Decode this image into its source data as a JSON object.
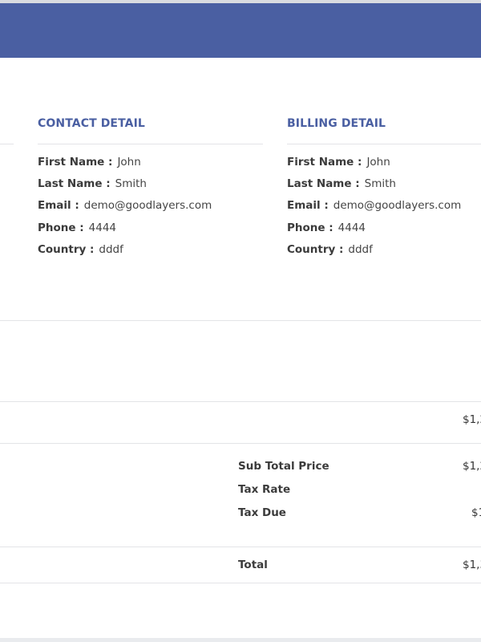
{
  "contact": {
    "title": "CONTACT DETAIL",
    "rows": [
      {
        "label": "First Name :",
        "value": "John"
      },
      {
        "label": "Last Name :",
        "value": "Smith"
      },
      {
        "label": "Email :",
        "value": "demo@goodlayers.com"
      },
      {
        "label": "Phone :",
        "value": "4444"
      },
      {
        "label": "Country :",
        "value": "dddf"
      }
    ]
  },
  "billing": {
    "title": "BILLING DETAIL",
    "rows": [
      {
        "label": "First Name :",
        "value": "John"
      },
      {
        "label": "Last Name :",
        "value": "Smith"
      },
      {
        "label": "Email :",
        "value": "demo@goodlayers.com"
      },
      {
        "label": "Phone :",
        "value": "4444"
      },
      {
        "label": "Country :",
        "value": "dddf"
      }
    ]
  },
  "item_row": {
    "price_partial": "$1,2"
  },
  "summary": {
    "subtotal_label": "Sub Total Price",
    "subtotal_partial": "$1,2",
    "tax_rate_label": "Tax Rate",
    "tax_due_label": "Tax Due",
    "tax_due_partial": "$1",
    "total_label": "Total",
    "total_partial": "$1,3"
  },
  "colors": {
    "accent": "#4a5fa2",
    "header": "#4a5fa2"
  }
}
